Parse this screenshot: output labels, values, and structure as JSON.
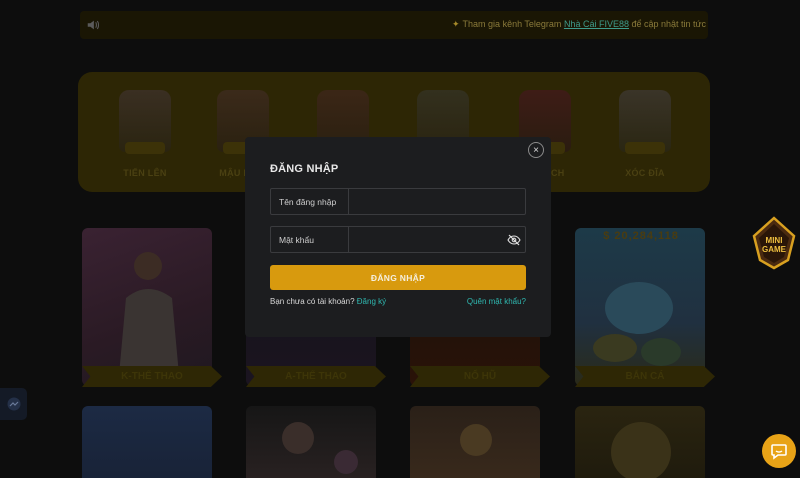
{
  "marquee": {
    "star": "✦",
    "text_before": "Tham gia kênh Telegram ",
    "link_text": "Nhà Cái FIVE88",
    "text_after": " để cập nhật tin tức mới n"
  },
  "categories": [
    {
      "label": "TIẾN LÊN"
    },
    {
      "label": "MẬU BINH"
    },
    {
      "label": ""
    },
    {
      "label": ""
    },
    {
      "label": "XÌ DÁCH"
    },
    {
      "label": "XÓC ĐĨA"
    }
  ],
  "cards": [
    {
      "label": "K-THỂ THAO"
    },
    {
      "label": "A-THỂ THAO"
    },
    {
      "label": "NỔ HŨ"
    },
    {
      "label": "BẮN CÁ"
    }
  ],
  "jackpot": "$ 20,284,118",
  "login_modal": {
    "title": "ĐĂNG NHẬP",
    "close_symbol": "×",
    "username_label": "Tên đăng nhập",
    "username_value": "",
    "password_label": "Mật khẩu",
    "password_value": "",
    "login_button": "ĐĂNG NHẬP",
    "no_account_text": "Bạn chưa có tài khoản?",
    "register_link": "Đăng ký",
    "forgot_link": "Quên mật khẩu?"
  },
  "mini_game": {
    "line1": "MINI",
    "line2": "GAME"
  },
  "colors": {
    "accent": "#d89a0e",
    "link": "#2fb8b0",
    "modal_bg": "#1c1d1f",
    "page_bg": "#0d0d0d"
  }
}
